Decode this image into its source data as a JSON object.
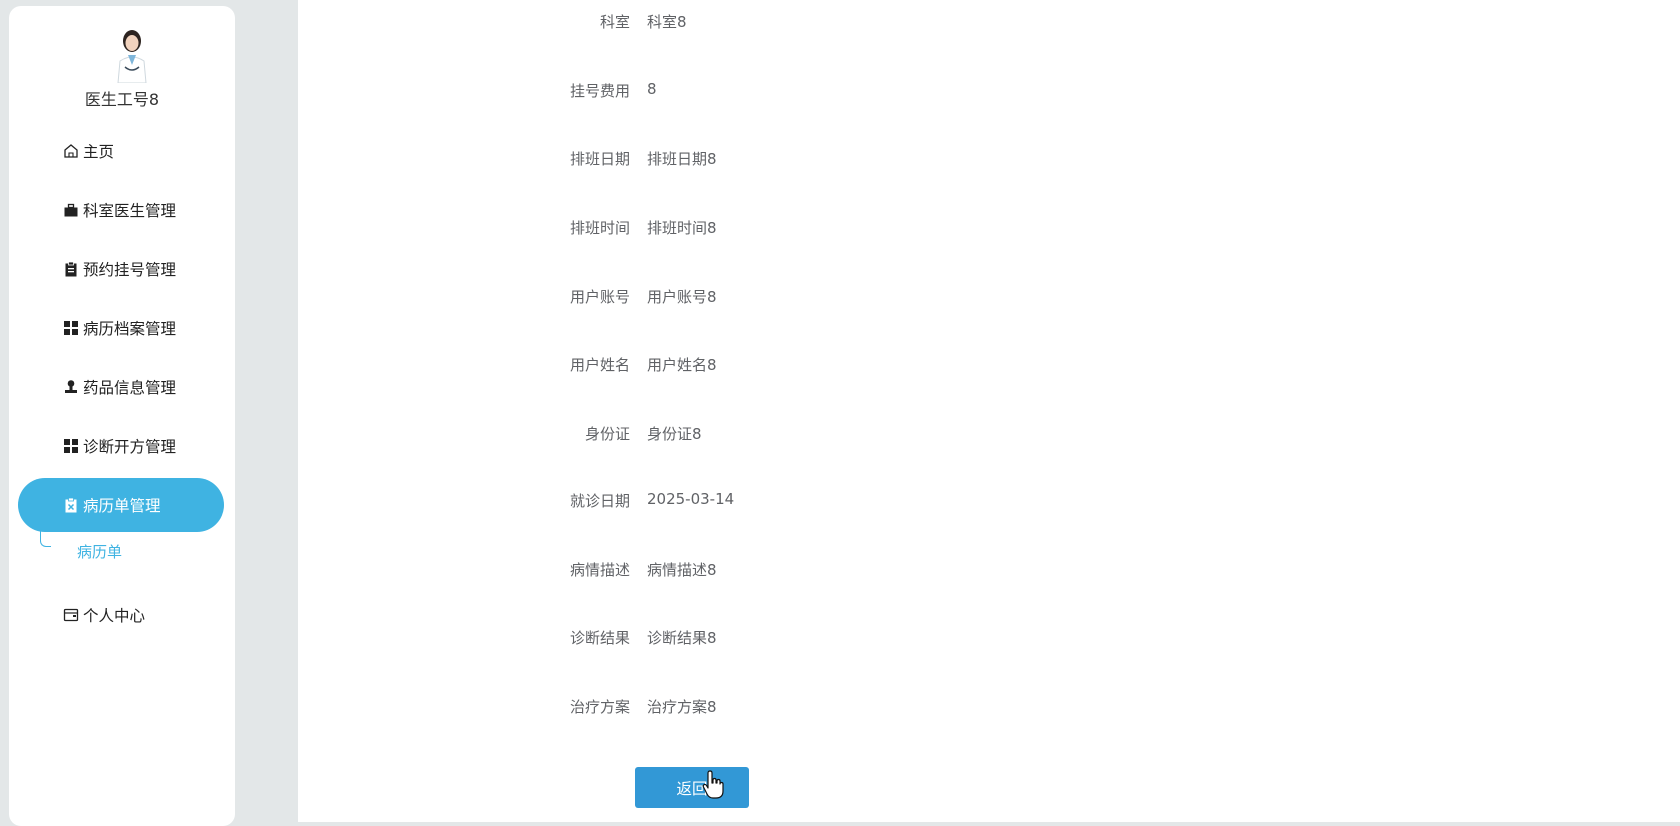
{
  "sidebar": {
    "username": "医生工号8",
    "menu": [
      {
        "label": "主页",
        "icon": "home-icon"
      },
      {
        "label": "科室医生管理",
        "icon": "briefcase-icon"
      },
      {
        "label": "预约挂号管理",
        "icon": "clipboard-icon"
      },
      {
        "label": "病历档案管理",
        "icon": "grid-icon"
      },
      {
        "label": "药品信息管理",
        "icon": "stamp-icon"
      },
      {
        "label": "诊断开方管理",
        "icon": "grid-icon"
      },
      {
        "label": "病历单管理",
        "icon": "clipboard-x-icon",
        "active": true
      },
      {
        "label": "个人中心",
        "icon": "wallet-icon"
      }
    ],
    "submenu_item": "病历单"
  },
  "form": {
    "rows": [
      {
        "label": "科室",
        "value": "科室8"
      },
      {
        "label": "挂号费用",
        "value": "8"
      },
      {
        "label": "排班日期",
        "value": "排班日期8"
      },
      {
        "label": "排班时间",
        "value": "排班时间8"
      },
      {
        "label": "用户账号",
        "value": "用户账号8"
      },
      {
        "label": "用户姓名",
        "value": "用户姓名8"
      },
      {
        "label": "身份证",
        "value": "身份证8"
      },
      {
        "label": "就诊日期",
        "value": "2025-03-14"
      },
      {
        "label": "病情描述",
        "value": "病情描述8"
      },
      {
        "label": "诊断结果",
        "value": "诊断结果8"
      },
      {
        "label": "治疗方案",
        "value": "治疗方案8"
      }
    ],
    "back_button": "返回"
  },
  "colors": {
    "accent": "#3fb3e2",
    "button": "#3298d6",
    "page_bg": "#e3e7e8"
  }
}
